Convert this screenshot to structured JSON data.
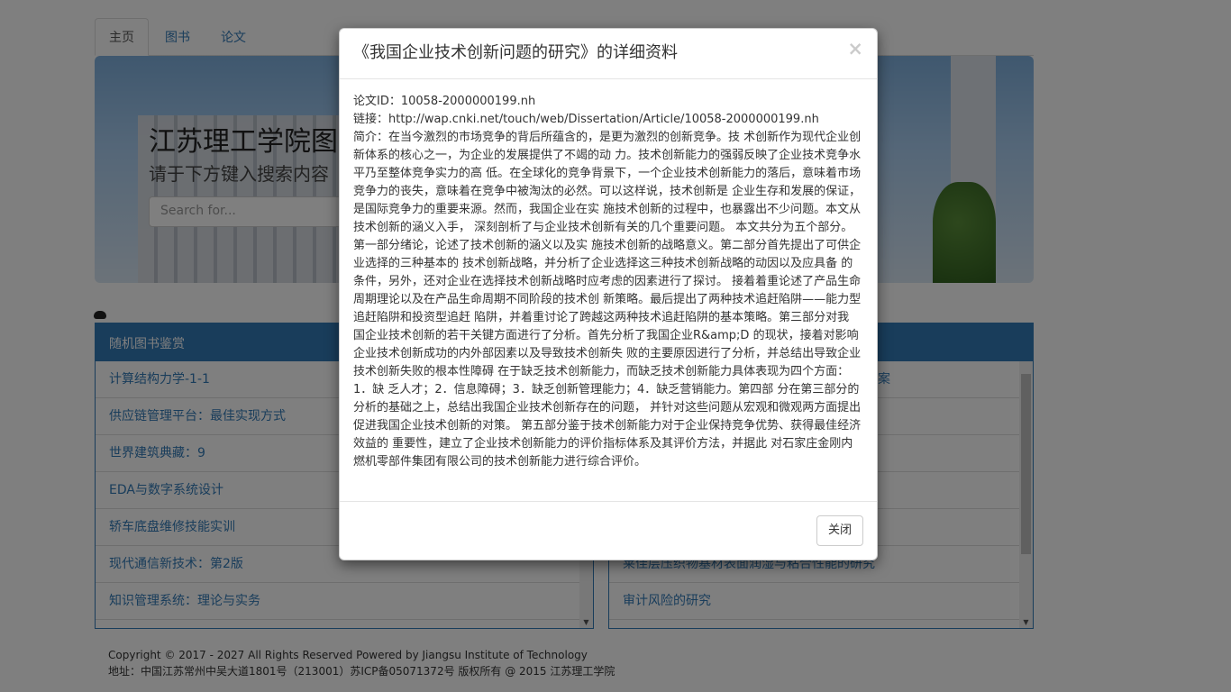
{
  "nav": {
    "tabs": [
      {
        "label": "主页"
      },
      {
        "label": "图书"
      },
      {
        "label": "论文"
      }
    ]
  },
  "hero": {
    "title": "江苏理工学院图",
    "subtitle": "请于下方键入搜索内容",
    "search_placeholder": "Search for..."
  },
  "left_panel": {
    "heading": "随机图书鉴赏",
    "items": [
      "计算结构力学-1-1",
      "供应链管理平台：最佳实现方式",
      "世界建筑典藏：9",
      "EDA与数字系统设计",
      "轿车底盘维修技能实训",
      "现代通信新技术：第2版",
      "知识管理系统：理论与实务"
    ]
  },
  "right_panel": {
    "items": [
      "决方案",
      "",
      "",
      "",
      "",
      "莱佳层压织物基材表面润湿与粘合性能的研究",
      "审计风险的研究"
    ]
  },
  "footer": {
    "line1": "Copyright © 2017 - 2027 All Rights Reserved Powered by Jiangsu Institute of Technology",
    "line2": "地址：中国江苏常州中吴大道1801号（213001）苏ICP备05071372号   版权所有 @ 2015 江苏理工学院"
  },
  "modal": {
    "title": "《我国企业技术创新问题的研究》的详细资料",
    "close_symbol": "×",
    "id_line": "论文ID：10058-2000000199.nh",
    "link_line": "链接：http://wap.cnki.net/touch/web/Dissertation/Article/10058-2000000199.nh",
    "summary": "简介：在当今激烈的市场竞争的背后所蕴含的，是更为激烈的创新竞争。技 术创新作为现代企业创新体系的核心之一，为企业的发展提供了不竭的动 力。技术创新能力的强弱反映了企业技术竞争水平乃至整体竞争实力的高 低。在全球化的竞争背景下，一个企业技术创新能力的落后，意味着市场 竞争力的丧失，意味着在竞争中被淘汰的必然。可以这样说，技术创新是 企业生存和发展的保证，是国际竞争力的重要来源。然而，我国企业在实 施技术创新的过程中，也暴露出不少问题。本文从技术创新的涵义入手， 深刻剖析了与企业技术创新有关的几个重要问题。 本文共分为五个部分。第一部分绪论，论述了技术创新的涵义以及实 施技术创新的战略意义。第二部分首先提出了可供企业选择的三种基本的 技术创新战略，并分析了企业选择这三种技术创新战略的动因以及应具备 的条件，另外，还对企业在选择技术创新战略时应考虑的因素进行了探讨。 接着着重论述了产品生命周期理论以及在产品生命周期不同阶段的技术创 新策略。最后提出了两种技术追赶陷阱——能力型追赶陷阱和投资型追赶 陷阱，并着重讨论了跨越这两种技术追赶陷阱的基本策略。第三部分对我 国企业技术创新的若干关键方面进行了分析。首先分析了我国企业R&amp;D 的现状，接着对影响企业技术创新成功的内外部因素以及导致技术创新失 败的主要原因进行了分析，并总结出导致企业技术创新失败的根本性障碍 在于缺乏技术创新能力，而缺乏技术创新能力具体表现为四个方面：1．缺 乏人才；2．信息障碍；3．缺乏创新管理能力；4．缺乏营销能力。第四部 分在第三部分的分析的基础之上，总结出我国企业技术创新存在的问题， 并针对这些问题从宏观和微观两方面提出促进我国企业技术创新的对策。 第五部分鉴于技术创新能力对于企业保持竞争优势、获得最佳经济效益的 重要性，建立了企业技术创新能力的评价指标体系及其评价方法，并据此 对石家庄金刚内燃机零部件集团有限公司的技术创新能力进行综合评价。",
    "close_button": "关闭"
  }
}
